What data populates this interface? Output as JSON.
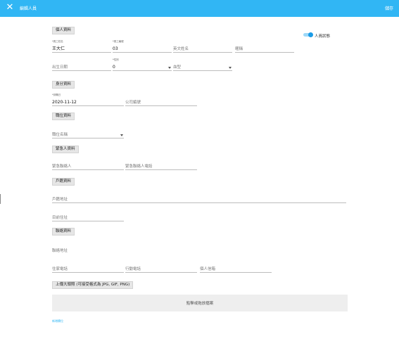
{
  "header": {
    "close_icon": "close-icon",
    "title": "編輯人員",
    "save_label": "儲存"
  },
  "status_toggle": {
    "label": "人員狀態",
    "on": true,
    "accent": "#1a9be6"
  },
  "sections": {
    "personal": "個人資料",
    "identity": "身分資料",
    "position": "職位資料",
    "emergency": "緊急人資料",
    "address": "戶籍資料",
    "contact": "聯絡資料",
    "upload": "上傳大頭照 (可接受格式為 JPG, GIF, PNG)"
  },
  "personal": {
    "surname_label": "*員工姓名",
    "surname_value": "王大仁",
    "id_label": "*員工編號",
    "id_value": "03",
    "english_name_placeholder": "英文姓名",
    "nickname_placeholder": "暱稱",
    "birthday_placeholder": "出生日期",
    "gender_label": "*性別",
    "gender_value": "0",
    "blood_placeholder": "血型"
  },
  "identity": {
    "onboard_label": "*到職日",
    "onboard_value": "2020-11-12",
    "company_id_placeholder": "公司編號"
  },
  "position": {
    "department_placeholder": "職位名稱"
  },
  "emergency": {
    "contact_name_placeholder": "緊急聯絡人",
    "contact_phone_placeholder": "緊急聯絡人電話"
  },
  "address": {
    "registered_placeholder": "戶籍地址",
    "residence_placeholder": "目前住址"
  },
  "contact": {
    "note_label": "聯絡地址",
    "home_phone_placeholder": "住家電話",
    "mobile_placeholder": "行動電話",
    "email_placeholder": "個人信箱"
  },
  "upload": {
    "dropzone_text": "點擊或拖放檔案"
  },
  "footer": {
    "link": "新增欄位"
  }
}
